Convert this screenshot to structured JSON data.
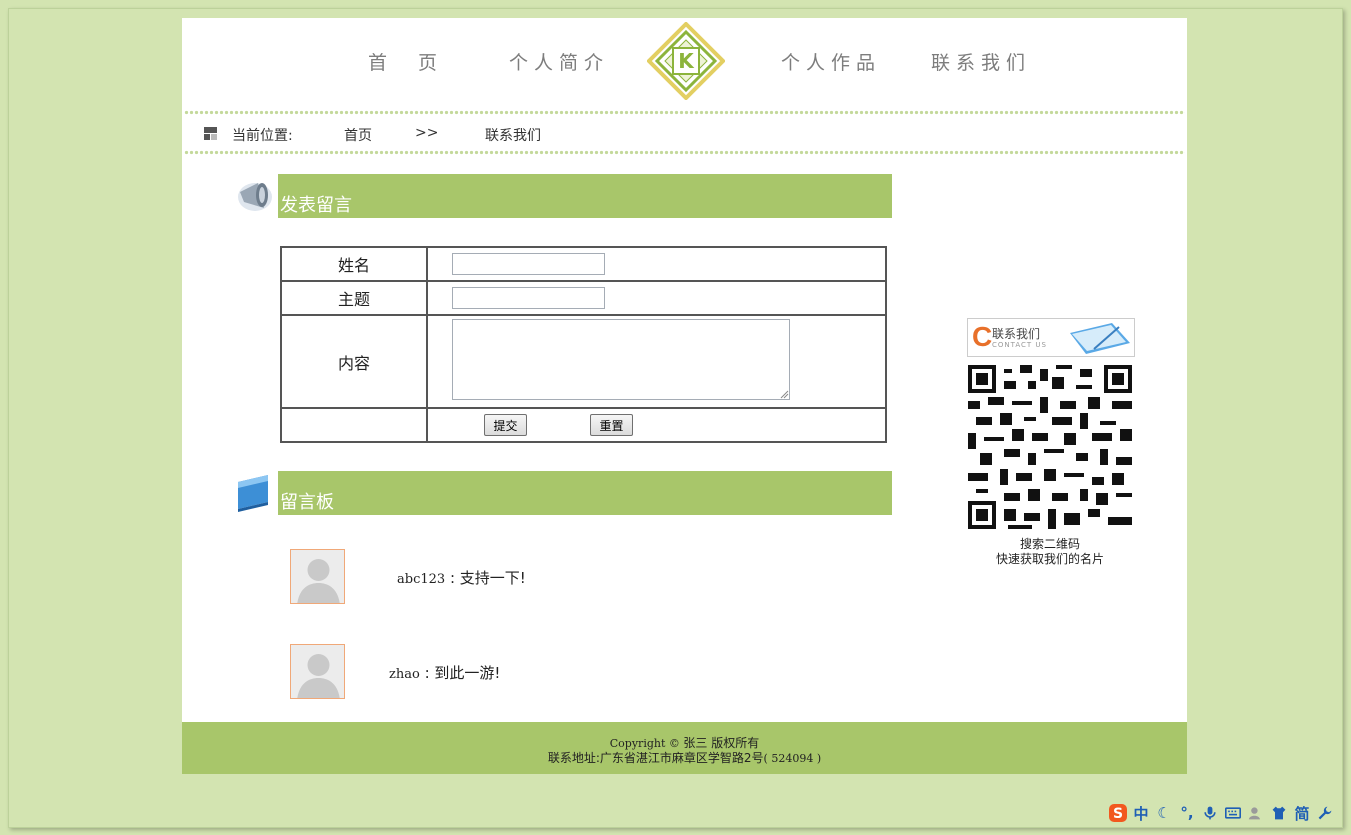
{
  "nav": {
    "items": [
      "首　页",
      "个人简介",
      "个人作品",
      "联系我们"
    ],
    "logo_letter": "K"
  },
  "breadcrumb": {
    "label": "当前位置:",
    "home": "首页",
    "separator": ">>",
    "current": "联系我们"
  },
  "post_section": {
    "title": "发表留言",
    "fields": {
      "name_label": "姓名",
      "subject_label": "主题",
      "content_label": "内容",
      "name_value": "",
      "subject_value": "",
      "content_value": ""
    },
    "submit_label": "提交",
    "reset_label": "重置"
  },
  "board_section": {
    "title": "留言板",
    "messages": [
      {
        "user": "abc123",
        "sep": " : ",
        "text": "支持一下!"
      },
      {
        "user": "zhao",
        "sep": " : ",
        "text": "到此一游!"
      }
    ]
  },
  "sidebar": {
    "card_title": "联系我们",
    "card_subtitle": "CONTACT US",
    "qr_line1": "搜索二维码",
    "qr_line2": "快速获取我们的名片"
  },
  "footer": {
    "copyright": "Copyright © ",
    "owner": "张三  版权所有",
    "address": "联系地址:广东省湛江市麻章区学智路2号",
    "postcode": "( 524094 )"
  },
  "tray": {
    "lang": "中",
    "mode": "简"
  },
  "colors": {
    "background": "#d3e4b1",
    "accent": "#a8c66a",
    "logo_green": "#8cb43c",
    "logo_gold": "#e3cf62"
  }
}
